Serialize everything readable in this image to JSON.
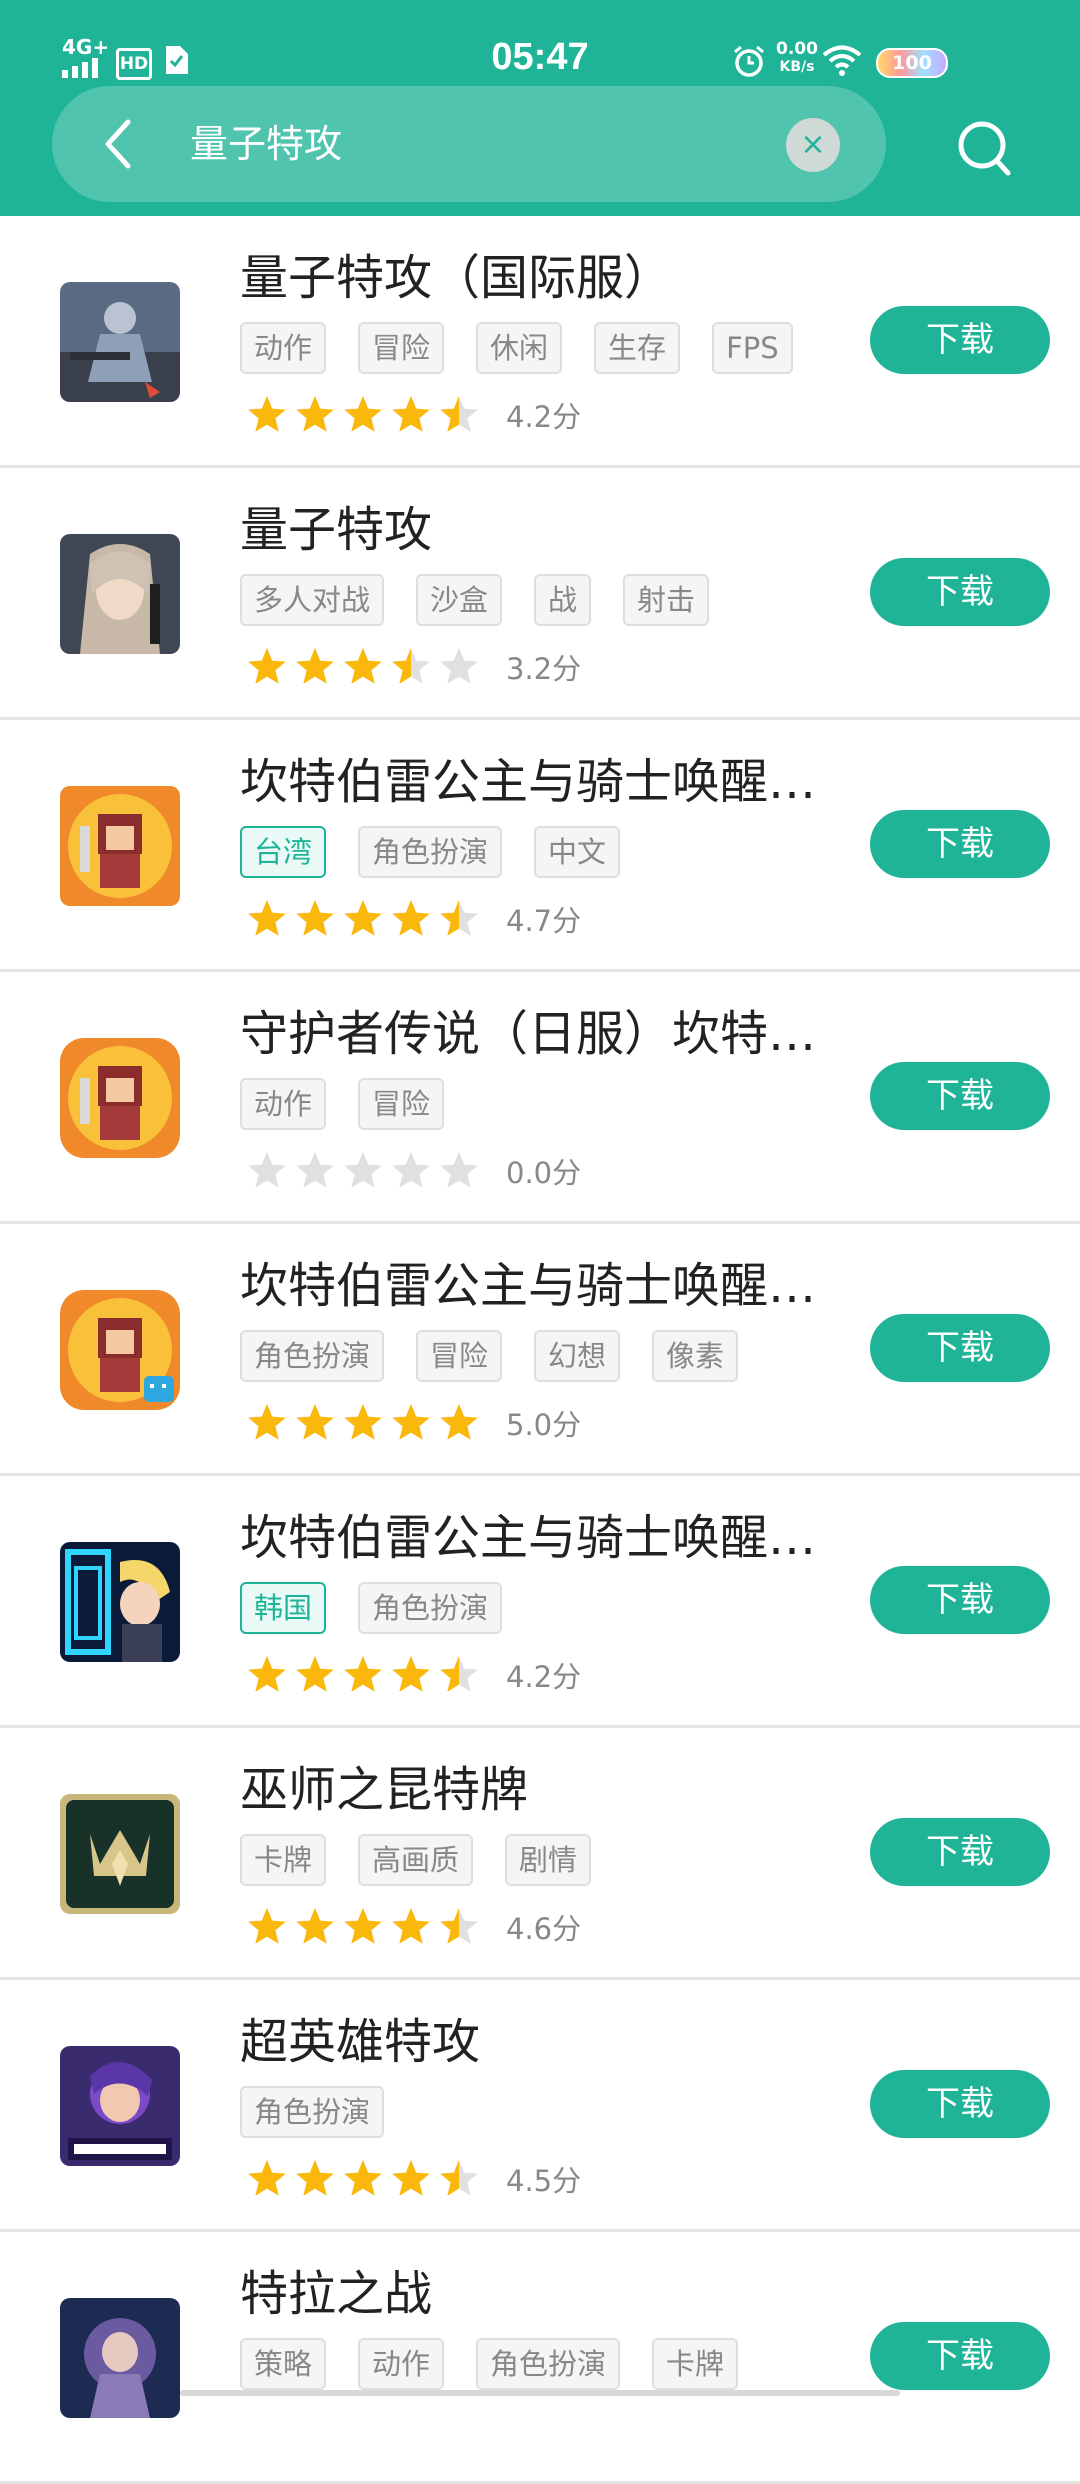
{
  "status_bar": {
    "time": "05:47",
    "network": "4G+",
    "hd": "HD",
    "speed_value": "0.00",
    "speed_unit": "KB/s",
    "battery": "100"
  },
  "search": {
    "query": "量子特攻",
    "clear_label": "×"
  },
  "colors": {
    "accent": "#1fb497",
    "star": "#f9b80b",
    "star_empty": "#e0e0e0"
  },
  "apps": [
    {
      "title": "量子特攻（国际服）",
      "tags": [
        "动作",
        "冒险",
        "休闲",
        "生存",
        "FPS"
      ],
      "region": "",
      "rating": 4.2,
      "score": "4.2分",
      "download": "下载"
    },
    {
      "title": "量子特攻",
      "tags": [
        "多人对战",
        "沙盒",
        "战",
        "射击"
      ],
      "region": "",
      "rating": 3.2,
      "score": "3.2分",
      "download": "下载"
    },
    {
      "title": "坎特伯雷公主与骑士唤醒…",
      "tags": [
        "台湾",
        "角色扮演",
        "中文"
      ],
      "region": "台湾",
      "rating": 4.7,
      "score": "4.7分",
      "download": "下载"
    },
    {
      "title": "守护者传说（日服）坎特…",
      "tags": [
        "动作",
        "冒险"
      ],
      "region": "",
      "rating": 0,
      "score": "0.0分",
      "download": "下载"
    },
    {
      "title": "坎特伯雷公主与骑士唤醒…",
      "tags": [
        "角色扮演",
        "冒险",
        "幻想",
        "像素"
      ],
      "region": "",
      "rating": 5.0,
      "score": "5.0分",
      "download": "下载"
    },
    {
      "title": "坎特伯雷公主与骑士唤醒…",
      "tags": [
        "韩国",
        "角色扮演"
      ],
      "region": "韩国",
      "rating": 4.2,
      "score": "4.2分",
      "download": "下载"
    },
    {
      "title": "巫师之昆特牌",
      "tags": [
        "卡牌",
        "高画质",
        "剧情"
      ],
      "region": "",
      "rating": 4.6,
      "score": "4.6分",
      "download": "下载"
    },
    {
      "title": "超英雄特攻",
      "tags": [
        "角色扮演"
      ],
      "region": "",
      "rating": 4.5,
      "score": "4.5分",
      "download": "下载"
    },
    {
      "title": "特拉之战",
      "tags": [
        "策略",
        "动作",
        "角色扮演",
        "卡牌"
      ],
      "region": "",
      "rating": 0,
      "score": "",
      "download": "下载"
    }
  ],
  "icon_names": [
    "soldier-game-icon",
    "female-soldier-game-icon",
    "pixel-knight-game-icon",
    "pixel-knight-game-icon",
    "pixel-knight-bilibili-game-icon",
    "anime-hero-game-icon",
    "gwent-crown-game-icon",
    "hero-girl-game-icon",
    "armored-warrior-game-icon"
  ]
}
